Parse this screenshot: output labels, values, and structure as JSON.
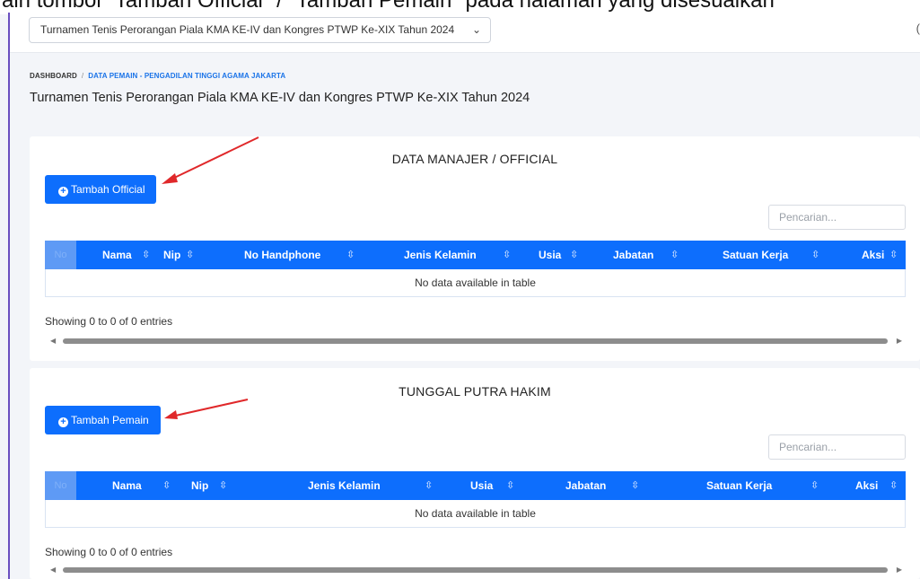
{
  "caption": "ain tombol \"Tambah Official\" / \"Tambah Pemain\" pada halaman yang disesuaikan",
  "topbar": {
    "event_select_value": "Turnamen Tenis Perorangan Piala KMA KE-IV dan Kongres PTWP Ke-XIX Tahun 2024",
    "right_edge_text": "("
  },
  "breadcrumb": {
    "home": "DASHBOARD",
    "separator": "/",
    "current": "DATA PEMAIN - PENGADILAN TINGGI AGAMA JAKARTA"
  },
  "page_title": "Turnamen Tenis Perorangan Piala KMA KE-IV dan Kongres PTWP Ke-XIX Tahun 2024",
  "colors": {
    "primary": "#0d6efd",
    "annotation_arrow": "#e0282a"
  },
  "sections": [
    {
      "title": "DATA MANAJER / OFFICIAL",
      "add_button_label": "Tambah Official",
      "search_placeholder": "Pencarian...",
      "columns": [
        "No",
        "Nama",
        "Nip",
        "No Handphone",
        "Jenis Kelamin",
        "Usia",
        "Jabatan",
        "Satuan Kerja",
        "Aksi"
      ],
      "sort_icon": "⇳",
      "empty_message": "No data available in table",
      "info": "Showing 0 to 0 of 0 entries"
    },
    {
      "title": "TUNGGAL PUTRA HAKIM",
      "add_button_label": "Tambah Pemain",
      "search_placeholder": "Pencarian...",
      "columns": [
        "No",
        "Nama",
        "Nip",
        "Jenis Kelamin",
        "Usia",
        "Jabatan",
        "Satuan Kerja",
        "Aksi"
      ],
      "sort_icon": "⇳",
      "empty_message": "No data available in table",
      "info": "Showing 0 to 0 of 0 entries"
    }
  ]
}
